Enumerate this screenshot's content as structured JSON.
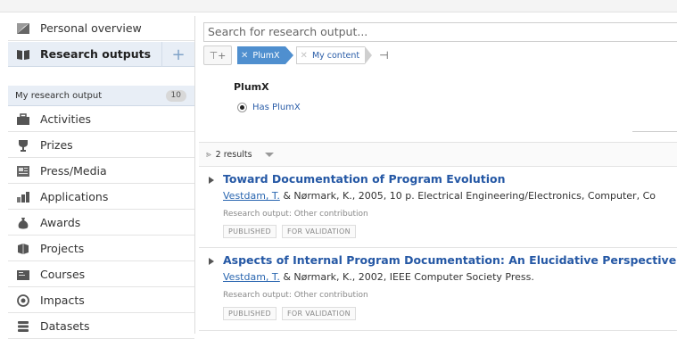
{
  "sidebar": {
    "items": [
      {
        "label": "Personal overview",
        "icon": "personal-overview-icon"
      },
      {
        "label": "Research outputs",
        "icon": "book-icon"
      },
      {
        "label": "Activities",
        "icon": "briefcase-icon"
      },
      {
        "label": "Prizes",
        "icon": "trophy-icon"
      },
      {
        "label": "Press/Media",
        "icon": "newspaper-icon"
      },
      {
        "label": "Applications",
        "icon": "applications-icon"
      },
      {
        "label": "Awards",
        "icon": "moneybag-icon"
      },
      {
        "label": "Projects",
        "icon": "projects-icon"
      },
      {
        "label": "Courses",
        "icon": "courses-icon"
      },
      {
        "label": "Impacts",
        "icon": "impact-icon"
      },
      {
        "label": "Datasets",
        "icon": "database-icon"
      }
    ],
    "add_symbol": "+",
    "sub_item": {
      "label": "My research output",
      "count": "10"
    }
  },
  "search": {
    "placeholder": "Search for research output..."
  },
  "filters": {
    "filter_button": "⊤+",
    "chips": [
      {
        "label": "PlumX"
      },
      {
        "label": "My content"
      }
    ],
    "pin_symbol": "⊣"
  },
  "panel": {
    "title": "PlumX",
    "option": "Has PlumX"
  },
  "results_bar": {
    "count_label": "2 results"
  },
  "results": [
    {
      "title": "Toward Documentation of Program Evolution",
      "author": "Vestdam, T.",
      "rest": " & Nørmark, K., 2005, 10 p. Electrical Engineering/Electronics, Computer, Co",
      "type": "Research output: Other contribution",
      "badges": [
        "PUBLISHED",
        "FOR VALIDATION"
      ]
    },
    {
      "title": "Aspects of Internal Program Documentation: An Elucidative Perspective",
      "author": "Vestdam, T.",
      "rest": " & Nørmark, K., 2002, IEEE Computer Society Press.",
      "type": "Research output: Other contribution",
      "badges": [
        "PUBLISHED",
        "FOR VALIDATION"
      ]
    }
  ]
}
